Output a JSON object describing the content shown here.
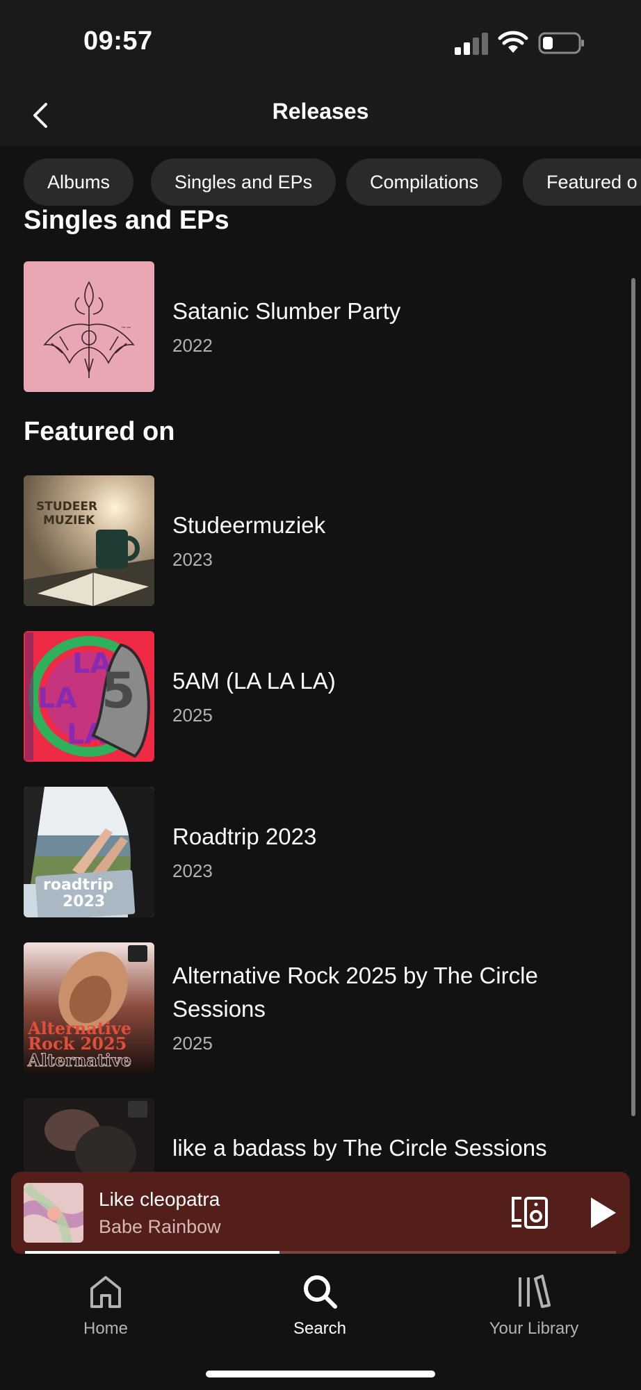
{
  "status_bar": {
    "time": "09:57"
  },
  "header": {
    "title": "Releases"
  },
  "chips": [
    {
      "label": "Albums"
    },
    {
      "label": "Singles and EPs"
    },
    {
      "label": "Compilations"
    },
    {
      "label": "Featured o"
    }
  ],
  "sections": {
    "singles": {
      "title": "Singles and EPs",
      "items": [
        {
          "name": "Satanic Slumber Party",
          "year": "2022"
        }
      ]
    },
    "featured": {
      "title": "Featured on",
      "items": [
        {
          "name": "Studeermuziek",
          "year": "2023",
          "cover_text": "STUDEER MUZIEK"
        },
        {
          "name": "5AM (LA LA LA)",
          "year": "2025"
        },
        {
          "name": "Roadtrip 2023",
          "year": "2023",
          "cover_text": "roadtrip 2023"
        },
        {
          "name": "Alternative Rock 2025 by The Circle Sessions",
          "year": "2025",
          "cover_text": "Alternative Rock 2025"
        },
        {
          "name": "like a badass by The Circle Sessions",
          "year": ""
        }
      ]
    }
  },
  "player": {
    "track": "Like cleopatra",
    "artist": "Babe Rainbow",
    "progress": 0.43,
    "bg_color": "#541f1b"
  },
  "nav": {
    "items": [
      {
        "label": "Home",
        "icon": "home-icon"
      },
      {
        "label": "Search",
        "icon": "search-icon",
        "active": true
      },
      {
        "label": "Your Library",
        "icon": "library-icon"
      }
    ]
  }
}
